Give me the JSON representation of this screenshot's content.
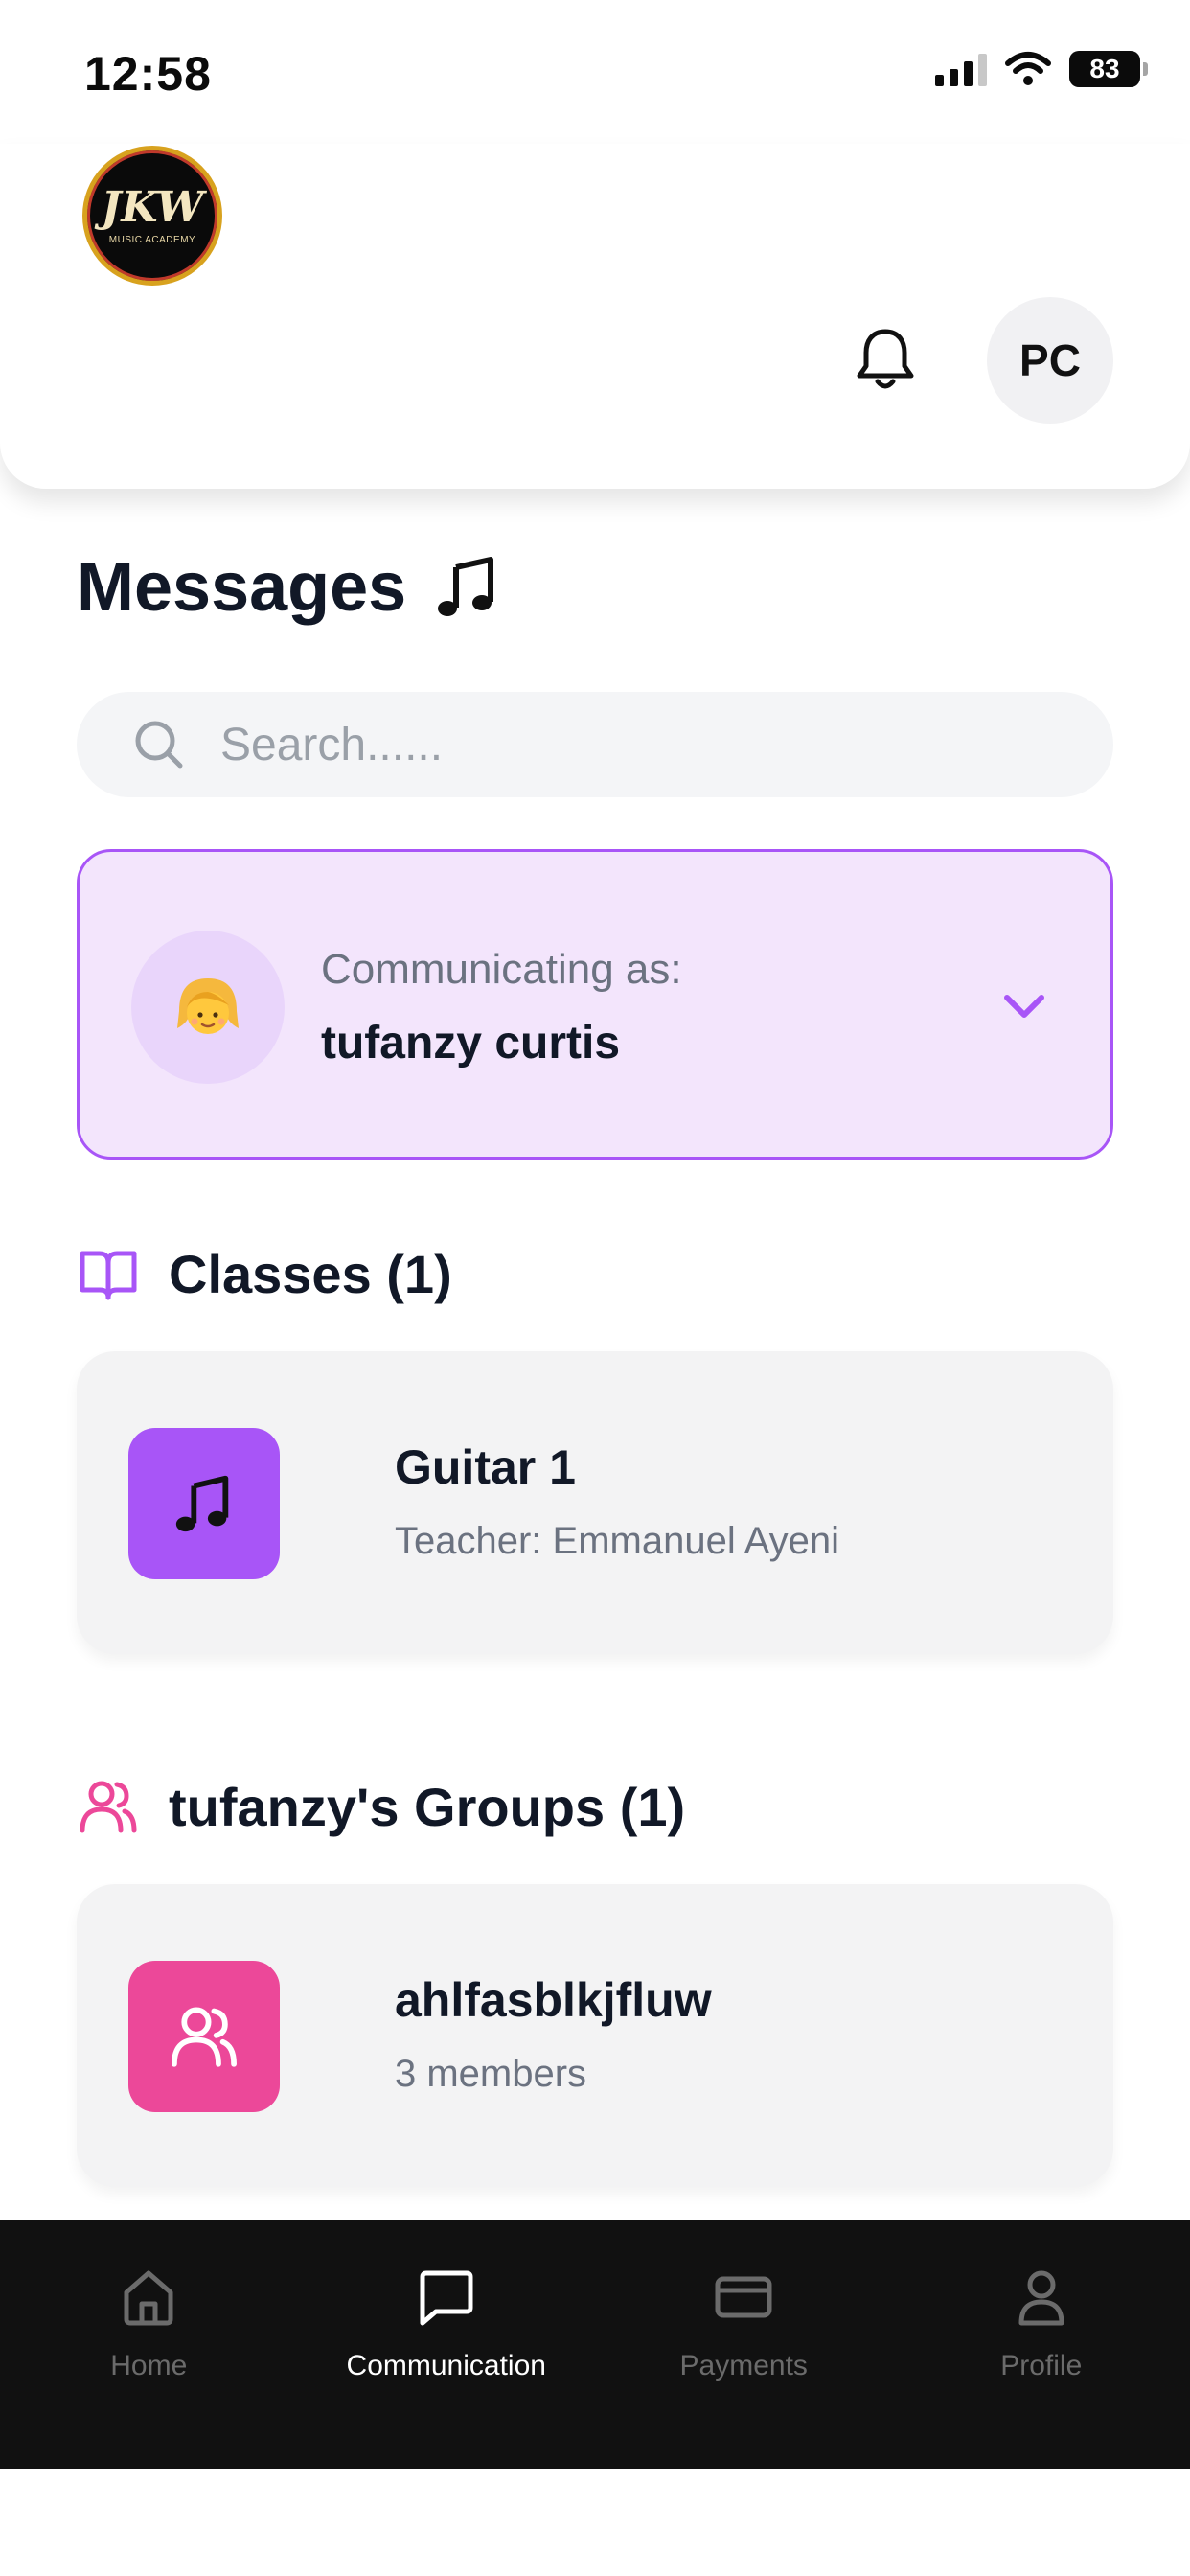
{
  "status_bar": {
    "time": "12:58",
    "battery": "83"
  },
  "header": {
    "logo_mark": "JKW",
    "logo_sub": "MUSIC ACADEMY",
    "avatar_initials": "PC"
  },
  "page": {
    "title": "Messages",
    "title_emoji": "music-note",
    "search_placeholder": "Search......"
  },
  "communicating_as": {
    "label": "Communicating as:",
    "name": "tufanzy curtis",
    "avatar_emoji": "👧"
  },
  "classes": {
    "heading": "Classes (1)",
    "items": [
      {
        "title": "Guitar 1",
        "subtitle": "Teacher: Emmanuel Ayeni",
        "icon": "music-note-icon",
        "icon_color": "#a855f7"
      }
    ]
  },
  "groups": {
    "heading": "tufanzy's Groups (1)",
    "items": [
      {
        "title": "ahlfasblkjfluw",
        "subtitle": "3 members",
        "icon": "users-icon",
        "icon_color": "#ec4899"
      }
    ]
  },
  "bottom_nav": {
    "items": [
      {
        "label": "Home",
        "icon": "home-icon",
        "active": false
      },
      {
        "label": "Communication",
        "icon": "message-icon",
        "active": true
      },
      {
        "label": "Payments",
        "icon": "card-icon",
        "active": false
      },
      {
        "label": "Profile",
        "icon": "user-icon",
        "active": false
      }
    ]
  },
  "colors": {
    "accent_purple": "#a855f7",
    "accent_pink": "#ec4899",
    "comm_card_bg": "#f3e5fc",
    "nav_bg": "#111111"
  }
}
